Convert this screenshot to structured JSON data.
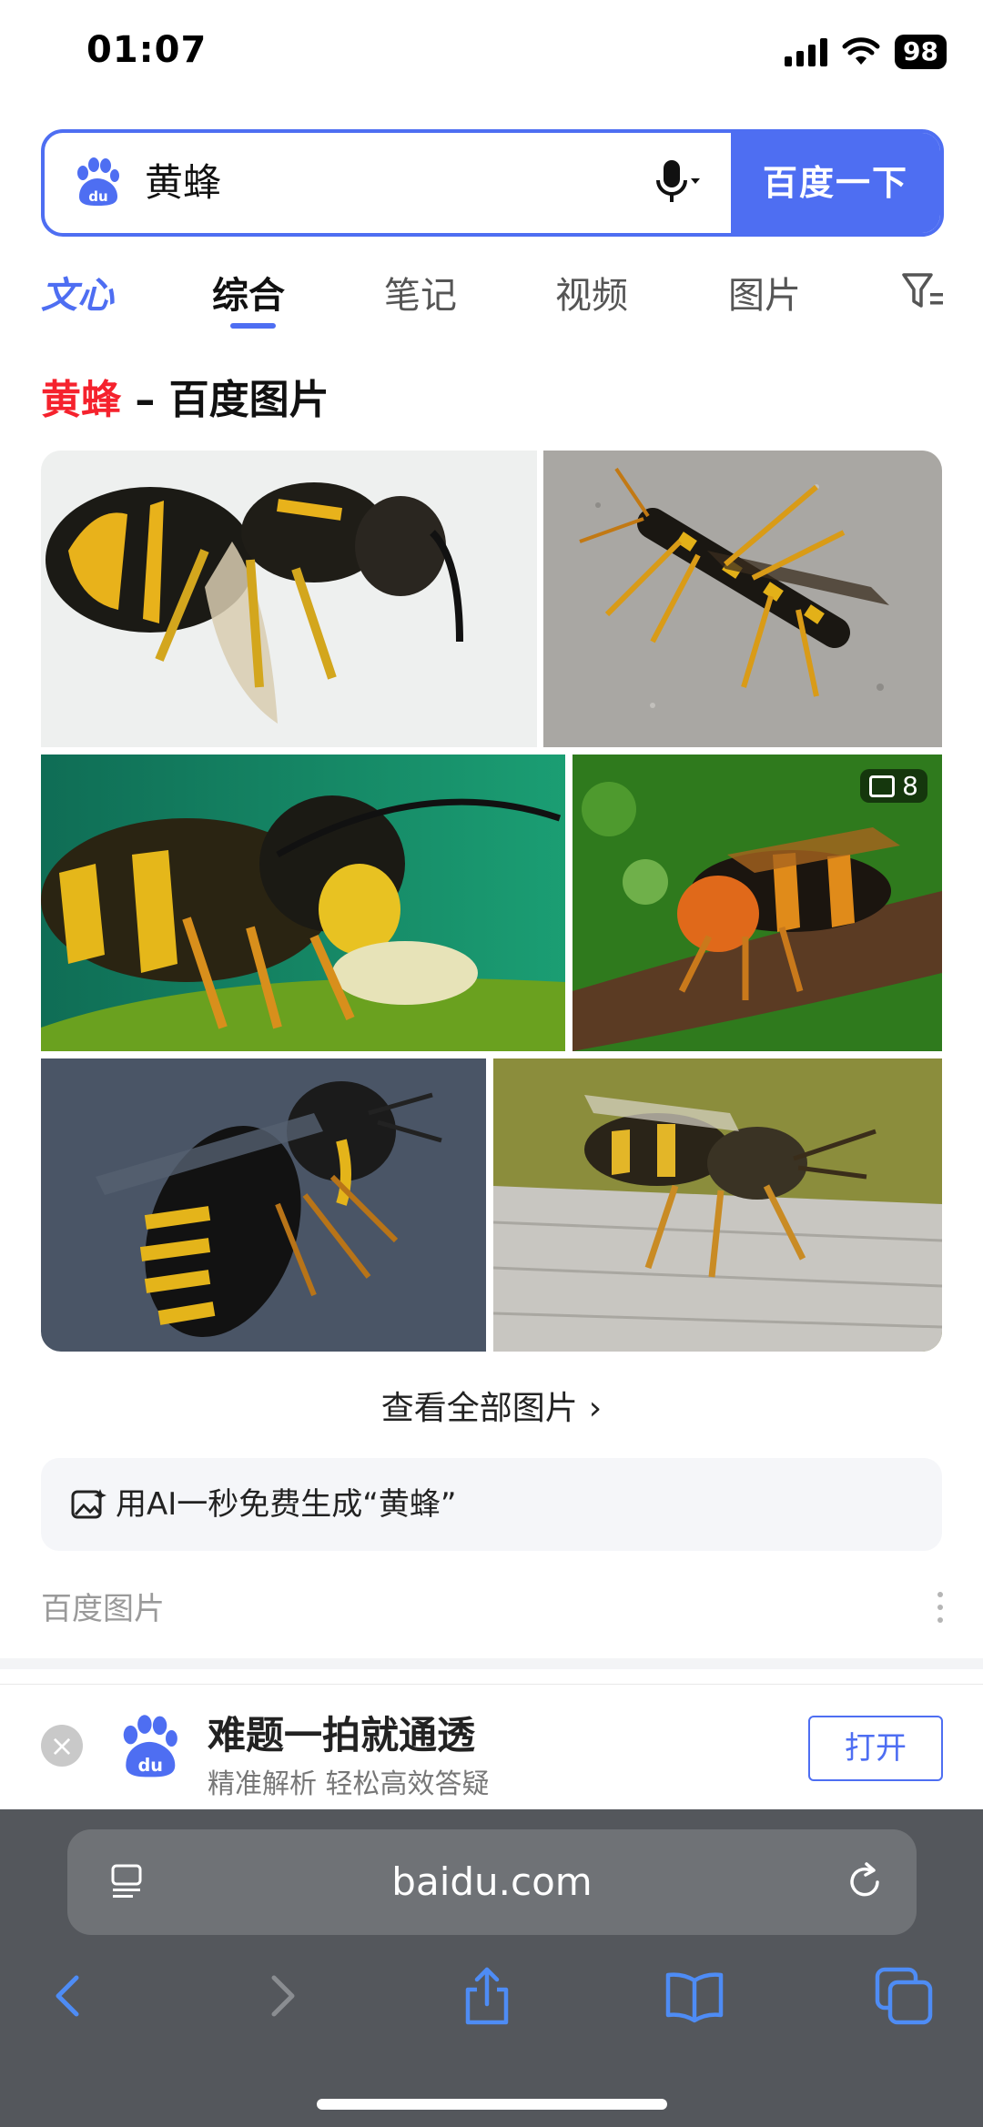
{
  "status_bar": {
    "time": "01:07",
    "battery": "98"
  },
  "search": {
    "query": "黄蜂",
    "button_label": "百度一下"
  },
  "tabs": [
    {
      "label": "文心"
    },
    {
      "label": "综合"
    },
    {
      "label": "笔记"
    },
    {
      "label": "视频"
    },
    {
      "label": "图片"
    }
  ],
  "results": {
    "title_keyword": "黄蜂",
    "title_rest": " – 百度图片",
    "image_count_badge": "8",
    "view_all_label": "查看全部图片",
    "ai_generate_label": "用AI一秒免费生成“黄蜂”",
    "source_label": "百度图片"
  },
  "app_banner": {
    "title": "难题一拍就通透",
    "subtitle": "精准解析 轻松高效答疑",
    "open_label": "打开"
  },
  "browser": {
    "url": "baidu.com"
  },
  "colors": {
    "accent": "#4e6ef2",
    "keyword_red": "#f5222d"
  }
}
